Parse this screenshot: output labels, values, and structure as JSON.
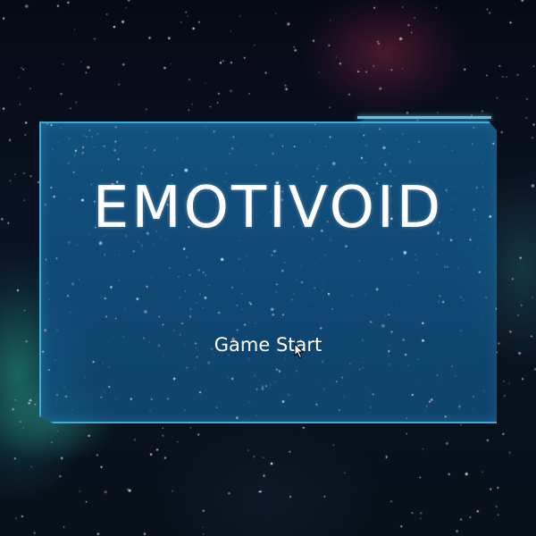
{
  "game": {
    "title": "EMOTIVOID",
    "start_label": "Game Start"
  },
  "colors": {
    "panel_fill": "#1a5f93",
    "panel_border": "#46bee9",
    "text": "#ffffff",
    "space_background": "#060a14",
    "nebula_teal": "#28aa96",
    "nebula_red": "#962846"
  },
  "icons": {
    "cursor": "mouse-pointer-arrow"
  }
}
